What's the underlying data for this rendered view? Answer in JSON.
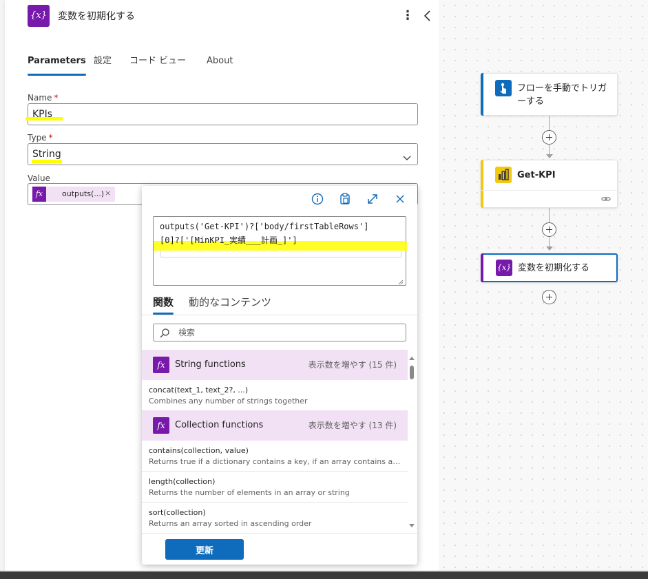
{
  "panel": {
    "title": "変数を初期化する",
    "action_icon_text": "{x}",
    "icons": {
      "more": "more-vertical-icon",
      "collapse": "chevron-left-icon"
    },
    "tabs": [
      {
        "label": "Parameters",
        "active": true
      },
      {
        "label": "設定",
        "active": false
      },
      {
        "label": "コード ビュー",
        "active": false
      },
      {
        "label": "About",
        "active": false
      }
    ],
    "fields": {
      "name": {
        "label": "Name",
        "required_mark": "*",
        "value": "KPIs"
      },
      "type": {
        "label": "Type",
        "required_mark": "*",
        "value": "String"
      },
      "value": {
        "label": "Value",
        "token_label": "outputs(...)",
        "token_icon_text": "fx",
        "token_remove": "×"
      }
    }
  },
  "expression_editor": {
    "toolbar_icons": [
      "info-icon",
      "clipboard-icon",
      "expand-icon",
      "close-icon"
    ],
    "expression": "outputs('Get-KPI')?['body/firstTableRows']\n[0]?['[MinKPI_実績___計画_]']",
    "tabs": [
      {
        "label": "関数",
        "active": true
      },
      {
        "label": "動的なコンテンツ",
        "active": false
      }
    ],
    "search": {
      "placeholder": "検索",
      "value": ""
    },
    "groups": [
      {
        "name": "String functions",
        "more_label": "表示数を増やす (15 件)",
        "icon_text": "fx",
        "functions": [
          {
            "signature": "concat(text_1, text_2?, ...)",
            "description": "Combines any number of strings together"
          }
        ]
      },
      {
        "name": "Collection functions",
        "more_label": "表示数を増やす (13 件)",
        "icon_text": "fx",
        "functions": [
          {
            "signature": "contains(collection, value)",
            "description": "Returns true if a dictionary contains a key, if an array contains a value, or if a string contains a substring"
          },
          {
            "signature": "length(collection)",
            "description": "Returns the number of elements in an array or string"
          },
          {
            "signature": "sort(collection)",
            "description": "Returns an array sorted in ascending order"
          }
        ]
      }
    ],
    "update_button": "更新"
  },
  "flow": {
    "nodes": [
      {
        "title": "フローを手動でトリガーする",
        "icon": "hand-touch-icon",
        "color": "#0f6cbd"
      },
      {
        "title": "Get-KPI",
        "icon": "excel-chart-icon",
        "color": "#f2c811",
        "extra_icon": "link-icon"
      },
      {
        "title": "変数を初期化する",
        "icon_text": "{x}",
        "color": "#7719aa",
        "selected": true
      }
    ]
  },
  "colors": {
    "accent": "#0f6cbd",
    "variable_purple": "#7719aa",
    "token_bg": "#f2e1f4",
    "highlight": "#ffff00",
    "powerbi_yellow": "#f2c811"
  }
}
